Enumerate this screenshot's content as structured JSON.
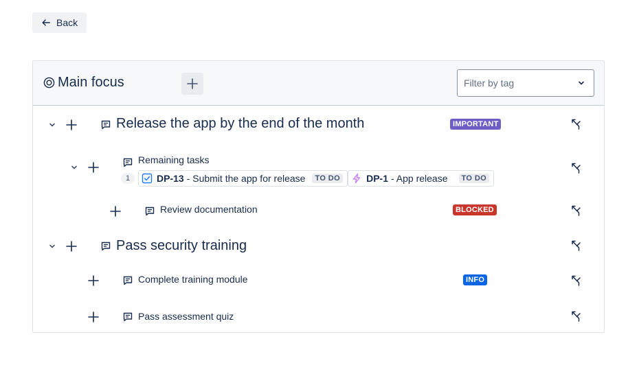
{
  "back": {
    "label": "Back"
  },
  "header": {
    "title": "Main focus",
    "filter_placeholder": "Filter by tag"
  },
  "rows": [
    {
      "title": "Release the app by the end of the month",
      "tag": "IMPORTANT"
    },
    {
      "title": "Remaining tasks",
      "count": "1",
      "issues": [
        {
          "key": "DP-13",
          "summary": "- Submit the app for release",
          "status": "TO DO",
          "icon": "task-checkbox-icon"
        },
        {
          "key": "DP-1",
          "summary": "- App release",
          "status": "TO DO",
          "icon": "epic-lightning-icon"
        }
      ]
    },
    {
      "title": "Review documentation",
      "tag": "BLOCKED"
    },
    {
      "title": "Pass security training"
    },
    {
      "title": "Complete training module",
      "tag": "INFO"
    },
    {
      "title": "Pass assessment quiz"
    }
  ],
  "colors": {
    "important": "#6e5dc6",
    "blocked": "#c9372c",
    "info": "#0c66e4",
    "text": "#172b4d"
  }
}
